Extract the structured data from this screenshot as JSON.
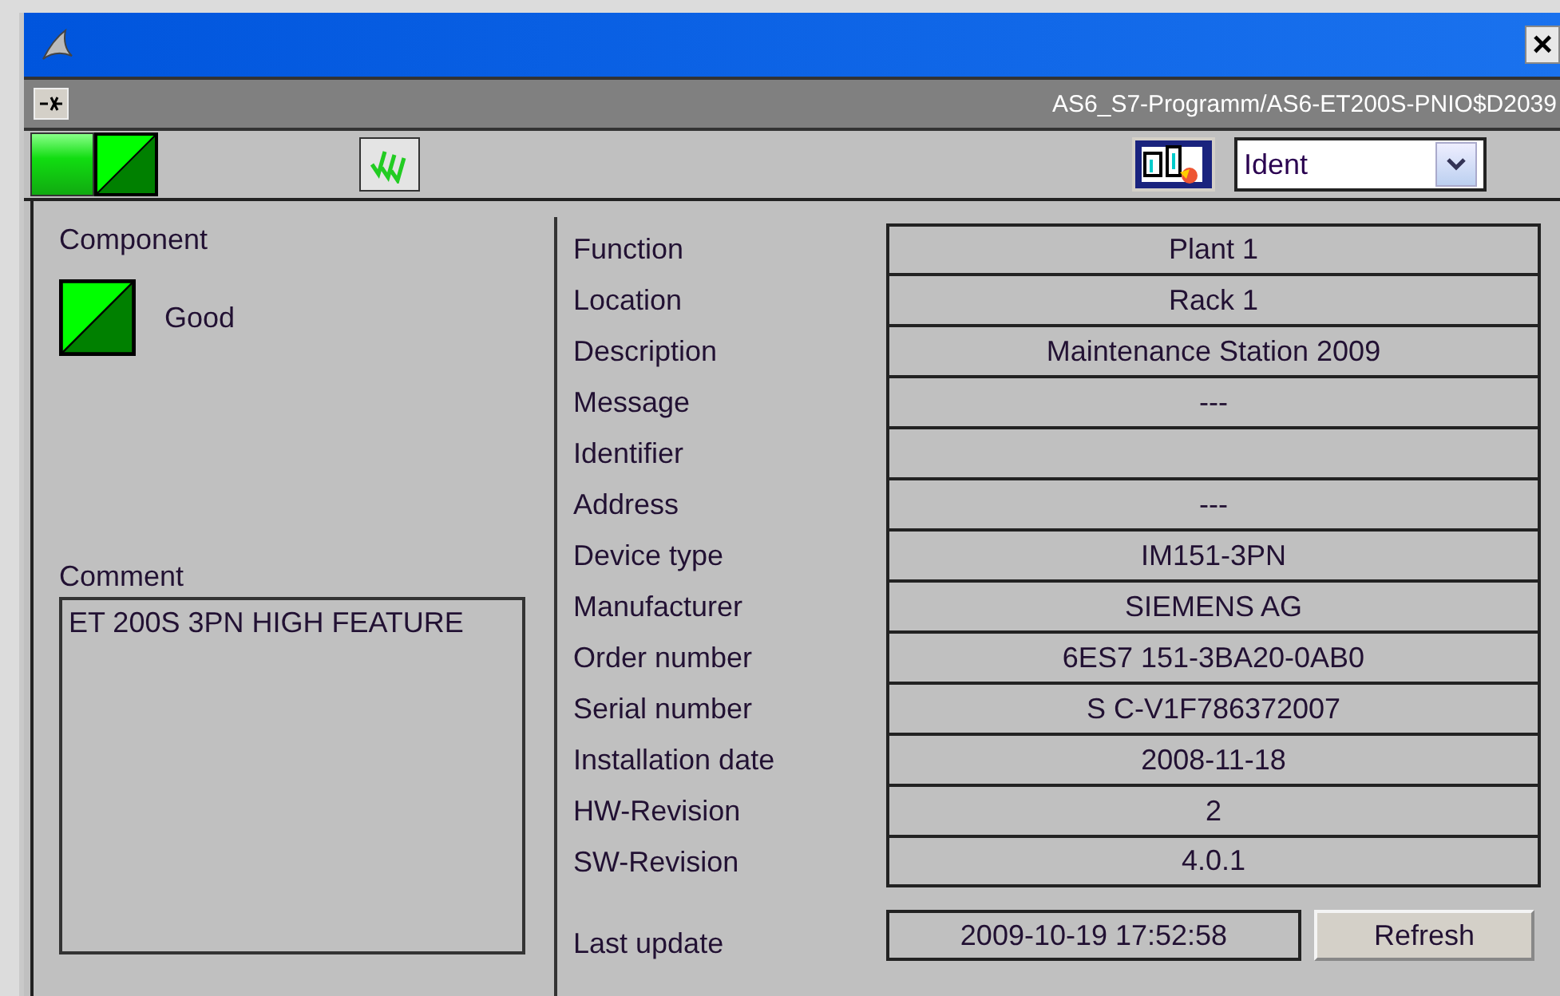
{
  "window": {
    "close_glyph": "×"
  },
  "header": {
    "path": "AS6_S7-Programm/AS6-ET200S-PNIO$D2039"
  },
  "toolbar": {
    "view_select": {
      "value": "Ident"
    }
  },
  "component": {
    "title": "Component",
    "status": {
      "kind": "good",
      "label": "Good"
    }
  },
  "comment": {
    "title": "Comment",
    "text": "ET 200S 3PN HIGH FEATURE"
  },
  "fields": [
    {
      "label": "Function",
      "value": "Plant 1"
    },
    {
      "label": "Location",
      "value": "Rack 1"
    },
    {
      "label": "Description",
      "value": "Maintenance Station 2009"
    },
    {
      "label": "Message",
      "value": "---"
    },
    {
      "label": "Identifier"
    },
    {
      "label": "Address",
      "value": "---"
    },
    {
      "label": "Device type",
      "value": "IM151-3PN"
    },
    {
      "label": "Manufacturer",
      "value": "SIEMENS AG"
    },
    {
      "label": "Order number",
      "value": "6ES7 151-3BA20-0AB0"
    },
    {
      "label": "Serial number",
      "value": "S C-V1F786372007"
    },
    {
      "label": "Installation date",
      "value": "2008-11-18"
    },
    {
      "label": "HW-Revision",
      "value": "2"
    },
    {
      "label": "SW-Revision",
      "value": "4.0.1"
    }
  ],
  "last_update": {
    "label": "Last update",
    "value": "2009-10-19 17:52:58"
  },
  "buttons": [
    {
      "label": "Refresh"
    }
  ]
}
